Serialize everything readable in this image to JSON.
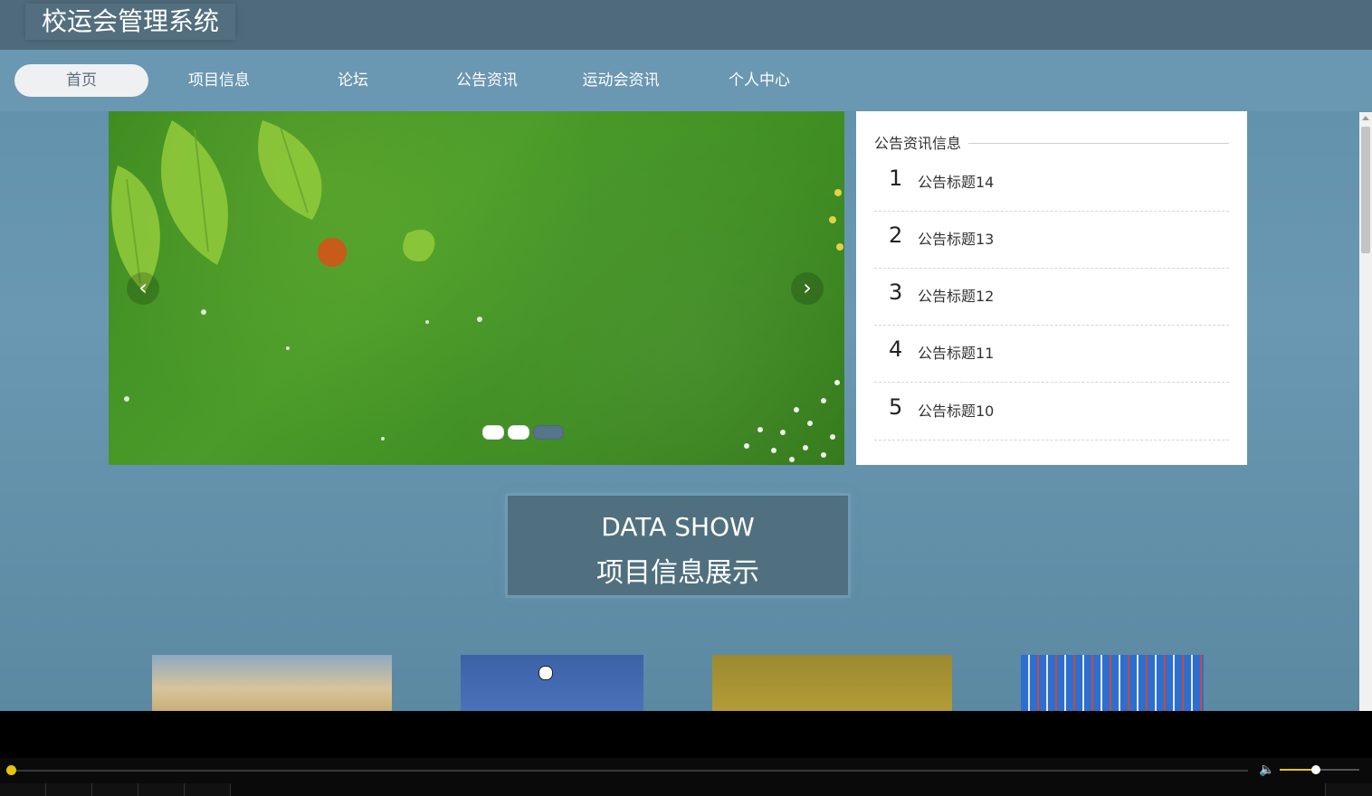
{
  "app": {
    "title": "校运会管理系统"
  },
  "nav": {
    "items": [
      {
        "label": "首页",
        "active": true
      },
      {
        "label": "项目信息",
        "active": false
      },
      {
        "label": "论坛",
        "active": false
      },
      {
        "label": "公告资讯",
        "active": false
      },
      {
        "label": "运动会资讯",
        "active": false
      },
      {
        "label": "个人中心",
        "active": false
      }
    ]
  },
  "carousel": {
    "prev_icon": "chevron-left-icon",
    "next_icon": "chevron-right-icon",
    "dots_count": 3,
    "active_dot": 3
  },
  "notice": {
    "title": "公告资讯信息",
    "items": [
      {
        "num": "1",
        "text": "公告标题14"
      },
      {
        "num": "2",
        "text": "公告标题13"
      },
      {
        "num": "3",
        "text": "公告标题12"
      },
      {
        "num": "4",
        "text": "公告标题11"
      },
      {
        "num": "5",
        "text": "公告标题10"
      }
    ]
  },
  "datashow": {
    "line1": "DATA SHOW",
    "line2": "项目信息展示"
  },
  "colors": {
    "topbar": "#4f6b7b",
    "nav": "#6a97b1",
    "accent": "#e6c40c"
  },
  "player": {
    "progress": 0.0,
    "volume": 0.45
  }
}
